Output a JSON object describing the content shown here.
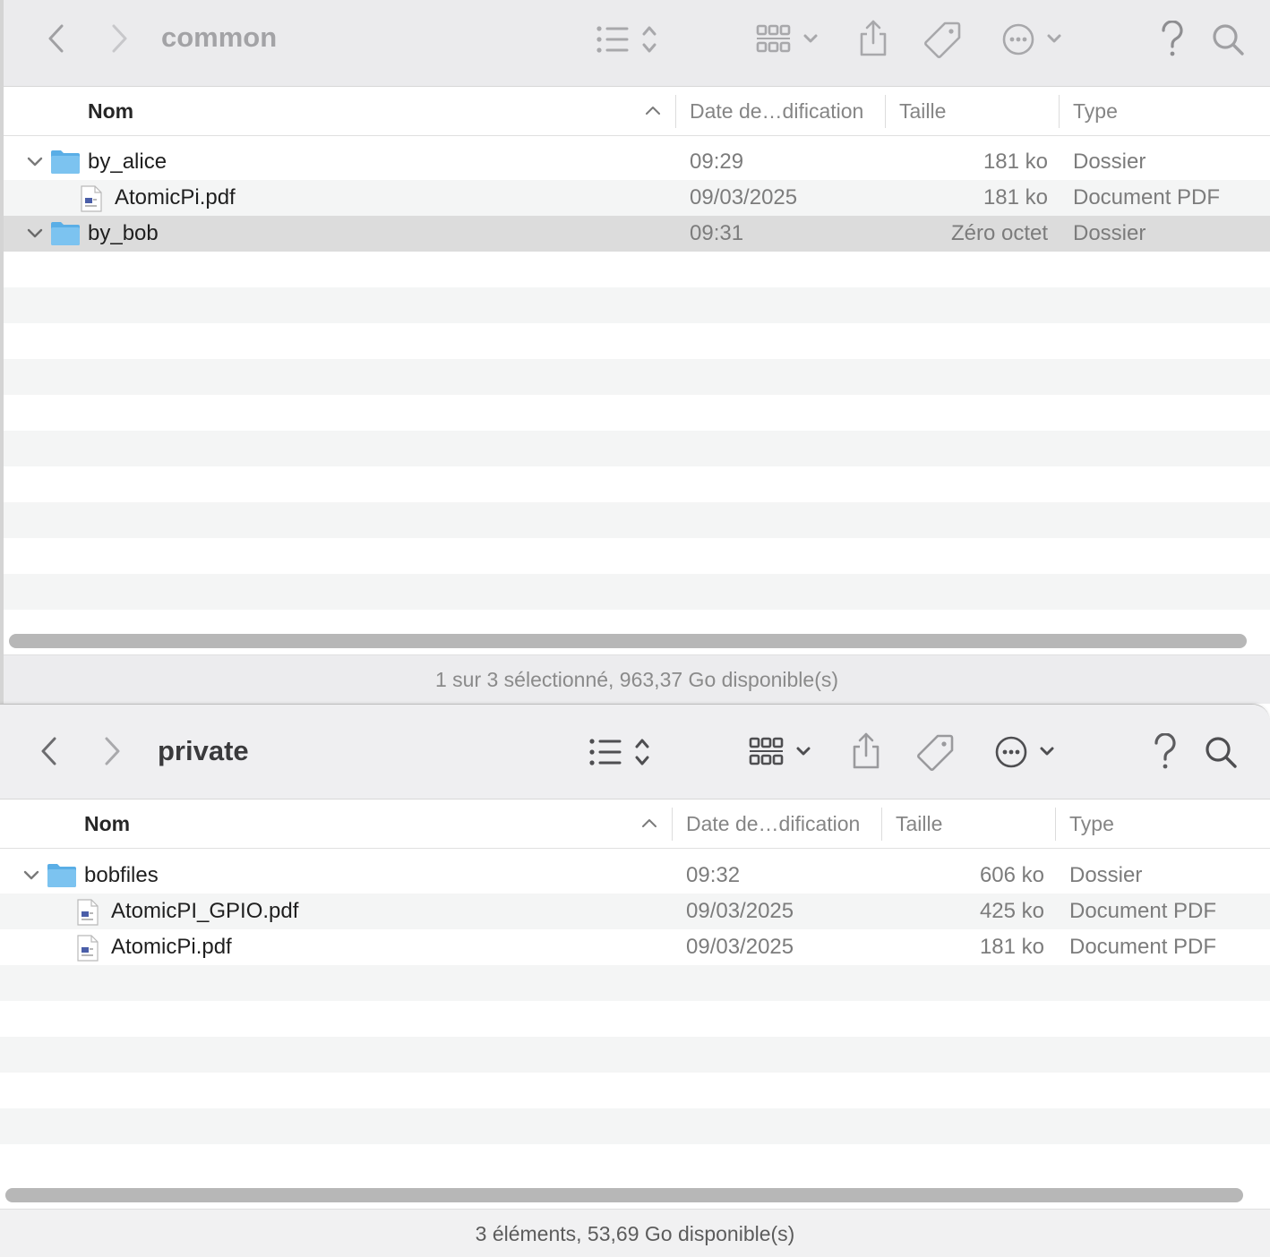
{
  "window_top": {
    "title": "common",
    "columns": {
      "name": "Nom",
      "date": "Date de…dification",
      "size": "Taille",
      "type": "Type"
    },
    "rows": [
      {
        "name": "by_alice",
        "date": "09:29",
        "size": "181 ko",
        "type": "Dossier",
        "kind": "folder",
        "expanded": true
      },
      {
        "name": "AtomicPi.pdf",
        "date": "09/03/2025",
        "size": "181 ko",
        "type": "Document PDF",
        "kind": "pdf"
      },
      {
        "name": "by_bob",
        "date": "09:31",
        "size": "Zéro octet",
        "type": "Dossier",
        "kind": "folder",
        "expanded": true,
        "selected": true
      }
    ],
    "status": "1 sur 3 sélectionné, 963,37 Go disponible(s)"
  },
  "window_bottom": {
    "title": "private",
    "columns": {
      "name": "Nom",
      "date": "Date de…dification",
      "size": "Taille",
      "type": "Type"
    },
    "rows": [
      {
        "name": "bobfiles",
        "date": "09:32",
        "size": "606 ko",
        "type": "Dossier",
        "kind": "folder",
        "expanded": true
      },
      {
        "name": "AtomicPI_GPIO.pdf",
        "date": "09/03/2025",
        "size": "425 ko",
        "type": "Document PDF",
        "kind": "pdf"
      },
      {
        "name": "AtomicPi.pdf",
        "date": "09/03/2025",
        "size": "181 ko",
        "type": "Document PDF",
        "kind": "pdf"
      }
    ],
    "status": "3 éléments, 53,69 Go disponible(s)"
  },
  "icons": [
    "back-icon",
    "forward-icon",
    "list-view-icon",
    "group-icon",
    "share-icon",
    "tag-icon",
    "more-icon",
    "help-icon",
    "search-icon",
    "folder-icon",
    "pdf-file-icon",
    "disclosure-chevron-icon",
    "sort-ascending-icon"
  ],
  "colors": {
    "folder": "#6ab8ea",
    "selection": "#dcdcdc",
    "toolbar": "#ebebed"
  }
}
